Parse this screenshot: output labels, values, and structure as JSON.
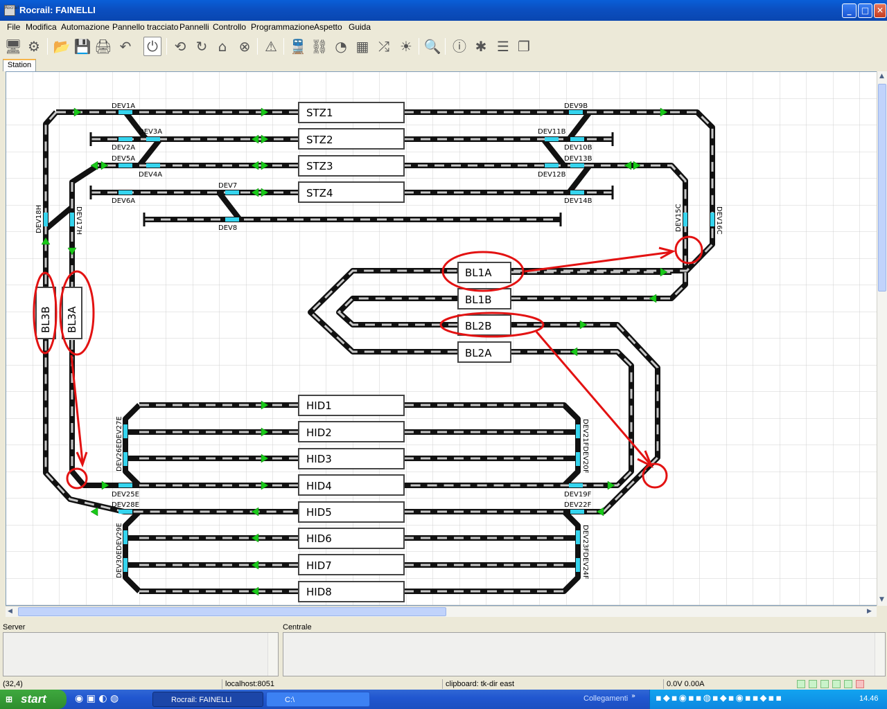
{
  "window": {
    "title": "Rocrail: FAINELLI",
    "icon_text": "Rocrail"
  },
  "menu": [
    "File",
    "Modifica",
    "Automazione",
    "Pannello tracciato",
    "Pannelli",
    "Controllo",
    "Programmazione",
    "Aspetto",
    "Guida"
  ],
  "toolbar_icons": [
    "monitor-icon",
    "gear-icon",
    "open-folder-icon",
    "save-icon",
    "print-icon",
    "undo-icon",
    "power-icon",
    "refresh-icon",
    "rotate-icon",
    "home-icon",
    "cancel-icon",
    "warning-icon",
    "locomotive-icon",
    "route-icon",
    "speedometer-icon",
    "switchbox-icon",
    "shuffle-icon",
    "light-icon",
    "search-icon",
    "info-icon",
    "bug-icon",
    "list-icon",
    "copy-icon"
  ],
  "tabs": [
    {
      "label": "Station",
      "active": true
    }
  ],
  "blocks": {
    "stz": [
      "STZ1",
      "STZ2",
      "STZ3",
      "STZ4"
    ],
    "bl": [
      "BL1A",
      "BL1B",
      "BL2B",
      "BL2A"
    ],
    "hid": [
      "HID1",
      "HID2",
      "HID3",
      "HID4",
      "HID5",
      "HID6",
      "HID7",
      "HID8"
    ],
    "vertical": [
      "BL3B",
      "BL3A"
    ]
  },
  "switch_labels": {
    "dev1a": "DEV1A",
    "dev2a": "DEV2A",
    "dev3a": "DEV3A",
    "dev4a": "DEV4A",
    "dev5a": "DEV5A",
    "dev6a": "DEV6A",
    "dev7": "DEV7",
    "dev8": "DEV8",
    "dev9b": "DEV9B",
    "dev10b": "DEV10B",
    "dev11b": "DEV11B",
    "dev12b": "DEV12B",
    "dev13b": "DEV13B",
    "dev14b": "DEV14B",
    "dev15c": "DEV15C",
    "dev16c": "DEV16C",
    "dev17h": "DEV17H",
    "dev18h": "DEV18H",
    "dev19f": "DEV19F",
    "dev22f": "DEV22F",
    "dev25e": "DEV25E",
    "dev28e": "DEV28E",
    "dev26e27e": "DEV26EDEV27E",
    "dev21f20f": "DEV21FDEV20F",
    "dev30e29e": "DEV30EDEV29E",
    "dev23f24f": "DEV23FDEV24F"
  },
  "panels": {
    "server": "Server",
    "centrale": "Centrale"
  },
  "status": {
    "coords": "(32,4)",
    "host": "localhost:8051",
    "clipboard": "clipboard: tk-dir east",
    "power": "0.0V 0.00A"
  },
  "taskbar": {
    "start": "start",
    "tasks": [
      "Rocrail: FAINELLI",
      "C:\\"
    ],
    "links": "Collegamenti",
    "clock": "14.46"
  },
  "colors": {
    "track": "#111111",
    "track_tie": "#c8c8c8",
    "signal": "#19c919",
    "switch_marker": "#35d4ee",
    "annotation": "#e31212",
    "block_border": "#444444"
  }
}
